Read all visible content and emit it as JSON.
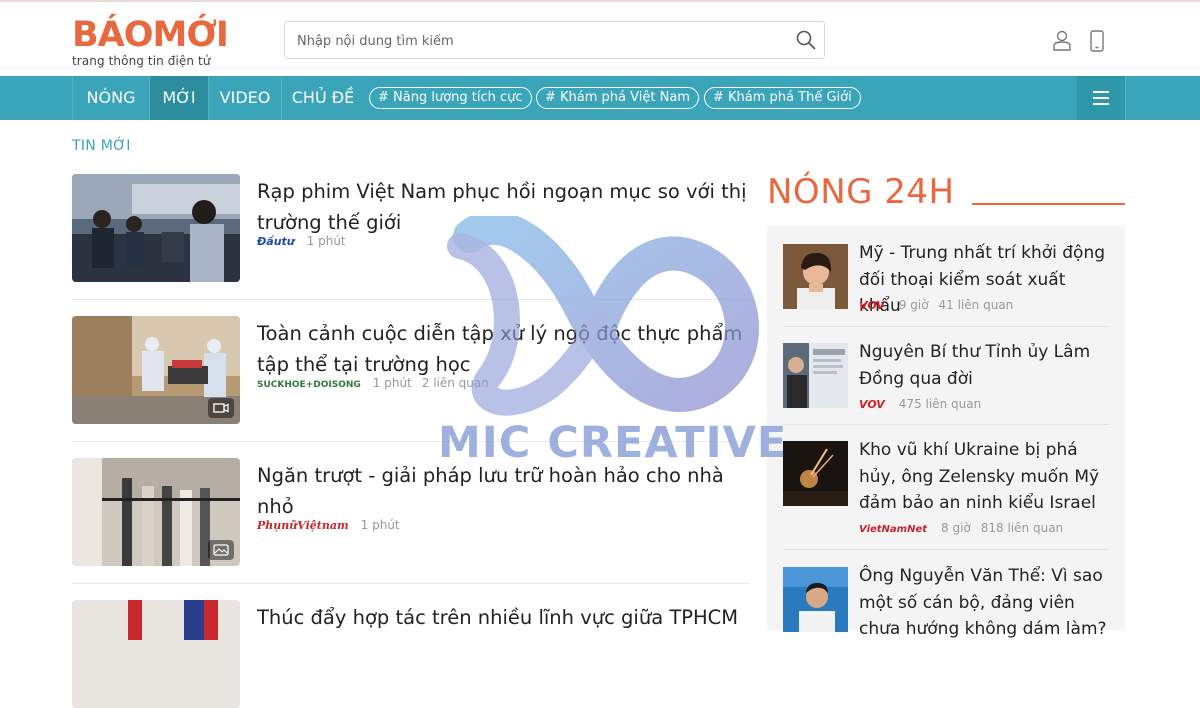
{
  "brand": {
    "logo_text": "BÁOMỚI",
    "tagline": "trang thông tin điện tử"
  },
  "search": {
    "placeholder": "Nhập nội dung tìm kiếm"
  },
  "nav": {
    "items": [
      "NÓNG",
      "MỚI",
      "VIDEO",
      "CHỦ ĐỀ"
    ],
    "active": "MỚI",
    "tags": [
      "# Năng lượng tích cực",
      "# Khám phá Việt Nam",
      "# Khám phá Thế Giới"
    ]
  },
  "section_title": "TIN MỚI",
  "articles": [
    {
      "title": "Rạp phim Việt Nam phục hồi ngoạn mục so với thị trường thế giới",
      "source": "Đầutư",
      "time": "1 phút",
      "related": ""
    },
    {
      "title": "Toàn cảnh cuộc diễn tập xử lý ngộ độc thực phẩm tập thể tại trường học",
      "source": "SUCKHOE+DOISONG",
      "time": "1 phút",
      "related": "2 liên quan"
    },
    {
      "title": "Ngăn trượt - giải pháp lưu trữ hoàn hảo cho nhà nhỏ",
      "source": "PhụnữViệtnam",
      "time": "1 phút",
      "related": ""
    },
    {
      "title": "Thúc đẩy hợp tác trên nhiều lĩnh vực giữa TPHCM",
      "source": "",
      "time": "",
      "related": ""
    }
  ],
  "hot": {
    "title": "NÓNG 24H",
    "items": [
      {
        "title": "Mỹ - Trung nhất trí khởi động đối thoại kiểm soát xuất khẩu",
        "source": "VOV",
        "time": "9 giờ",
        "related": "41 liên quan"
      },
      {
        "title": "Nguyên Bí thư Tỉnh ủy Lâm Đồng qua đời",
        "source": "VOV",
        "time": "",
        "related": "475 liên quan"
      },
      {
        "title": "Kho vũ khí Ukraine bị phá hủy, ông Zelensky muốn Mỹ đảm bảo an ninh kiểu Israel",
        "source": "VietNamNet",
        "time": "8 giờ",
        "related": "818 liên quan"
      },
      {
        "title": "Ông Nguyễn Văn Thể: Vì sao một số cán bộ, đảng viên chưa hướng không dám làm?",
        "source": "",
        "time": "",
        "related": ""
      }
    ]
  },
  "watermark": {
    "text": "MIC CREATIVE"
  },
  "colors": {
    "teal": "#3aa4b8",
    "orange": "#e8683f",
    "vov_red": "#d21f26"
  },
  "icons": [
    "search-icon",
    "user-icon",
    "phone-icon",
    "menu-icon",
    "video-icon",
    "gallery-icon"
  ]
}
